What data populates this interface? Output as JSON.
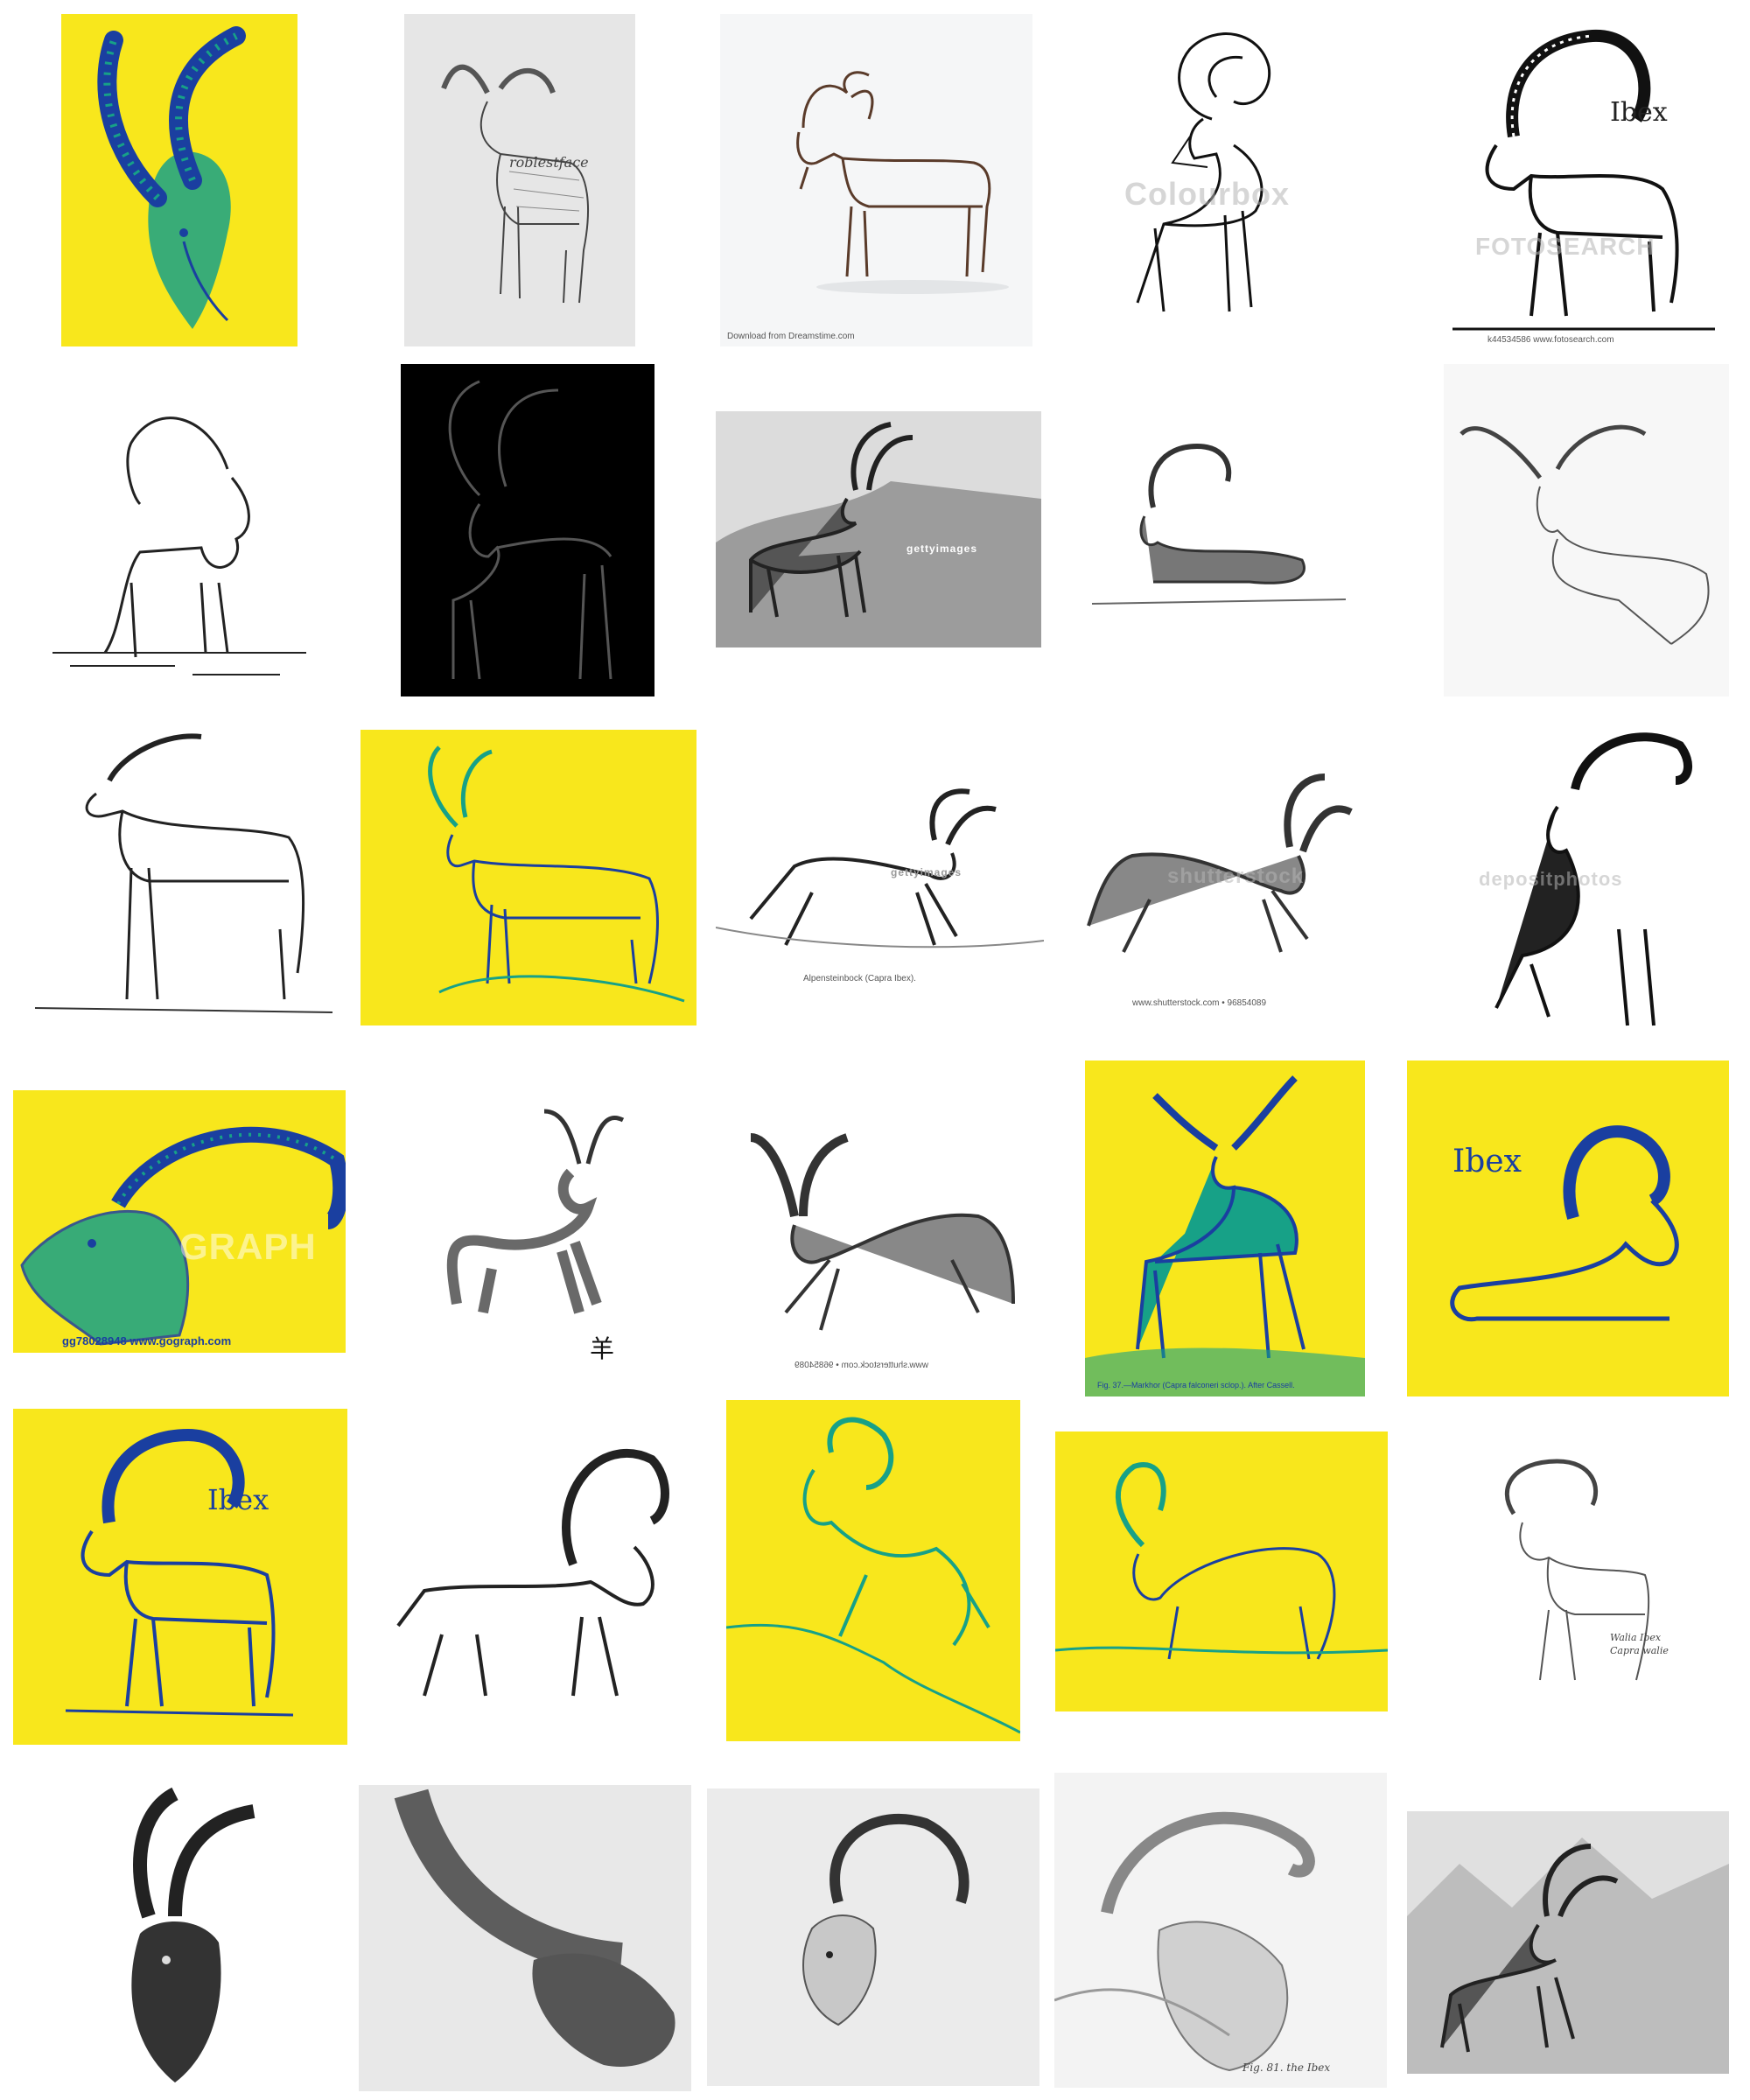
{
  "palette": {
    "yellow": "#f8e71c",
    "blue": "#1a3fa0",
    "teal": "#17a187",
    "ink": "#1b1b1b",
    "black": "#000000",
    "white": "#ffffff",
    "paper": "#e9e9e9"
  },
  "tiles": [
    {
      "id": "t01",
      "theme": "yellow",
      "style": "ibex-head-closeup",
      "icon": "ibex-head-icon"
    },
    {
      "id": "t02",
      "theme": "paper",
      "style": "pencil-standing-ibex",
      "icon": "ibex-icon",
      "texts": {
        "signature": "roblestface"
      }
    },
    {
      "id": "t03",
      "theme": "white",
      "style": "outline-goat",
      "icon": "goat-icon",
      "texts": {
        "credit": "Download from Dreamstime.com"
      }
    },
    {
      "id": "t04",
      "theme": "white",
      "style": "coloring-page-ibex",
      "icon": "ibex-icon",
      "texts": {
        "watermark": "Colourbox"
      }
    },
    {
      "id": "t05",
      "theme": "white",
      "style": "ibex-labeled",
      "icon": "ibex-icon",
      "texts": {
        "label": "Ibex",
        "watermark": "FOTOSEARCH",
        "credit": "k44534586  www.fotosearch.com"
      }
    },
    {
      "id": "t06",
      "theme": "white",
      "style": "bearded-ibex-line",
      "icon": "ibex-icon"
    },
    {
      "id": "t07",
      "theme": "black",
      "style": "ibex-outline-on-black",
      "icon": "ibex-icon"
    },
    {
      "id": "t08",
      "theme": "white",
      "style": "engraving-ibex-rocks",
      "icon": "ibex-icon",
      "texts": {
        "watermark": "gettyimages"
      }
    },
    {
      "id": "t09",
      "theme": "white",
      "style": "pencil-resting-ibex",
      "icon": "ibex-icon"
    },
    {
      "id": "t10",
      "theme": "white",
      "style": "sketch-ibex-ledge",
      "icon": "ibex-icon"
    },
    {
      "id": "t11",
      "theme": "white",
      "style": "ink-ibex-standing",
      "icon": "ibex-icon"
    },
    {
      "id": "t12",
      "theme": "yellow",
      "style": "yellow-outline-ibex",
      "icon": "ibex-icon"
    },
    {
      "id": "t13",
      "theme": "white",
      "style": "engraving-leaping-ibex",
      "icon": "ibex-icon",
      "texts": {
        "watermark": "gettyimages",
        "credit": "Alpensteinbock (Capra Ibex)."
      }
    },
    {
      "id": "t14",
      "theme": "white",
      "style": "leaping-ibex",
      "icon": "ibex-icon",
      "texts": {
        "watermark": "shutterstock",
        "credit": "www.shutterstock.com • 96854089"
      }
    },
    {
      "id": "t15",
      "theme": "white",
      "style": "bw-ibex-rock",
      "icon": "ibex-icon",
      "texts": {
        "watermark": "depositphotos"
      }
    },
    {
      "id": "t16",
      "theme": "yellow",
      "style": "ibex-head-left",
      "icon": "ibex-head-icon",
      "texts": {
        "watermark": "GRAPH",
        "credit": "gg78028948  www.gograph.com"
      }
    },
    {
      "id": "t17",
      "theme": "white",
      "style": "ink-wash-goat",
      "icon": "goat-icon",
      "texts": {
        "kanji": "羊"
      }
    },
    {
      "id": "t18",
      "theme": "white",
      "style": "mirrored-leaping-ibex",
      "icon": "ibex-icon",
      "texts": {
        "credit": "www.shutterstock.com • 96854089"
      }
    },
    {
      "id": "t19",
      "theme": "yellow",
      "style": "markhor-engraving",
      "icon": "markhor-icon",
      "texts": {
        "credit": "Fig. 37.—Markhor (Capra falconeri sclop.).  After Cassell."
      }
    },
    {
      "id": "t20",
      "theme": "yellow",
      "style": "ibex-lying-labeled",
      "icon": "ibex-icon",
      "texts": {
        "label": "Ibex"
      }
    },
    {
      "id": "t21",
      "theme": "yellow",
      "style": "ibex-labeled-yellow",
      "icon": "ibex-icon",
      "texts": {
        "label": "Ibex"
      }
    },
    {
      "id": "t22",
      "theme": "white",
      "style": "walking-ibex-ink",
      "icon": "ibex-icon"
    },
    {
      "id": "t23",
      "theme": "yellow",
      "style": "climbing-ibex-teal",
      "icon": "ibex-icon"
    },
    {
      "id": "t24",
      "theme": "yellow",
      "style": "grazing-ibex-teal",
      "icon": "ibex-icon"
    },
    {
      "id": "t25",
      "theme": "white",
      "style": "pencil-walia-ibex",
      "icon": "ibex-icon",
      "texts": {
        "note1": "Walia Ibex",
        "note2": "Capra walie"
      }
    },
    {
      "id": "t26",
      "theme": "white",
      "style": "ibex-head-dark",
      "icon": "ibex-head-icon"
    },
    {
      "id": "t27",
      "theme": "paper",
      "style": "charcoal-horn-closeup",
      "icon": "horn-icon"
    },
    {
      "id": "t28",
      "theme": "paper",
      "style": "pencil-ibex-head",
      "icon": "ibex-head-icon"
    },
    {
      "id": "t29",
      "theme": "paper",
      "style": "pencil-ibex-horn-rock",
      "icon": "ibex-head-icon",
      "texts": {
        "caption": "Fig. 81. the Ibex"
      }
    },
    {
      "id": "t30",
      "theme": "paper",
      "style": "mountain-ibex-engraving",
      "icon": "ibex-icon"
    }
  ]
}
